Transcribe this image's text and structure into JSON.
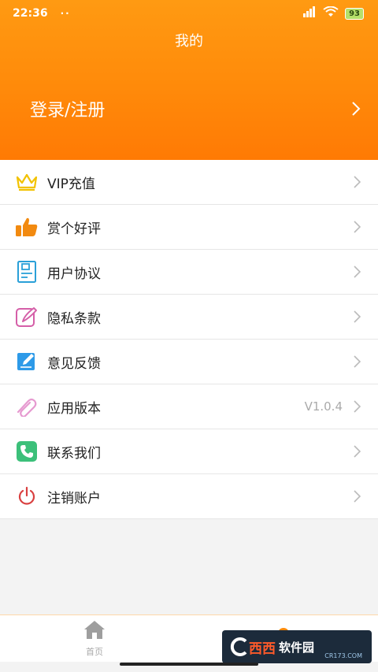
{
  "status_bar": {
    "time": "22:36",
    "dots": "··",
    "battery": "93"
  },
  "header": {
    "title": "我的",
    "login_label": "登录/注册"
  },
  "menu": [
    {
      "label": "VIP充值",
      "icon": "crown-icon",
      "value": ""
    },
    {
      "label": "赏个好评",
      "icon": "thumbs-up-icon",
      "value": ""
    },
    {
      "label": "用户协议",
      "icon": "document-icon",
      "value": ""
    },
    {
      "label": "隐私条款",
      "icon": "pen-note-icon",
      "value": ""
    },
    {
      "label": "意见反馈",
      "icon": "edit-icon",
      "value": ""
    },
    {
      "label": "应用版本",
      "icon": "paperclip-icon",
      "value": "V1.0.4"
    },
    {
      "label": "联系我们",
      "icon": "phone-icon",
      "value": ""
    },
    {
      "label": "注销账户",
      "icon": "power-icon",
      "value": ""
    }
  ],
  "tabbar": {
    "home_label": "首页"
  },
  "watermark": {
    "main": "西西",
    "sub": "软件园",
    "url": "CR173.COM"
  },
  "colors": {
    "accent": "#ff8a0a",
    "crown": "#f2c200",
    "thumb": "#f28a10",
    "doc": "#2aa0d8",
    "pen": "#d55fa8",
    "edit": "#2d9ae8",
    "clip": "#e69ad0",
    "phone": "#3cc07a",
    "power": "#d94040"
  }
}
